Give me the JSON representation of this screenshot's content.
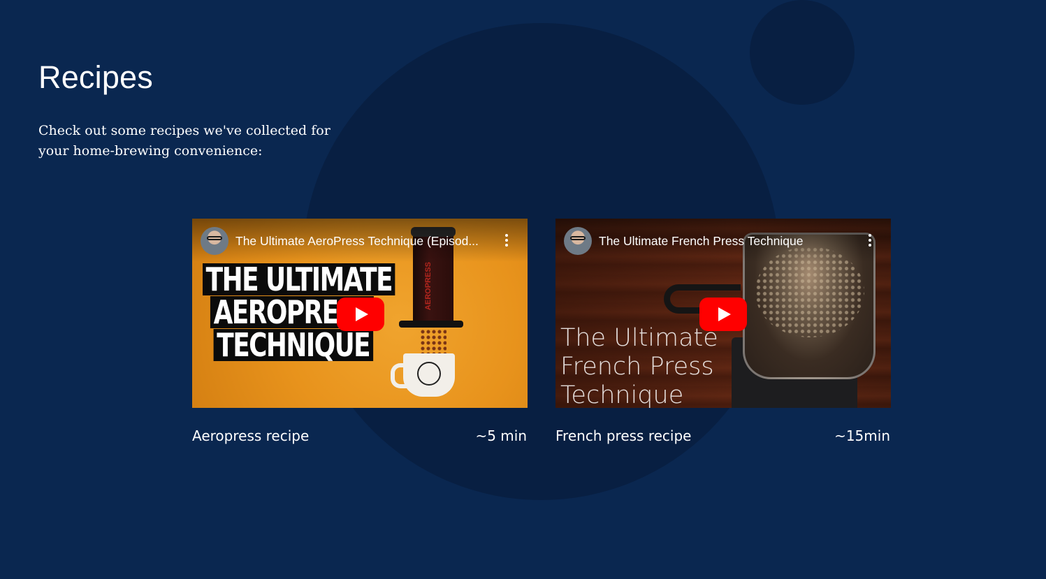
{
  "page": {
    "title": "Recipes",
    "intro": "Check out some recipes we've collected for your home-brewing convenience:"
  },
  "recipes": [
    {
      "video_title": "The Ultimate AeroPress Technique (Episod...",
      "thumbnail_text": [
        "THE ULTIMATE",
        "AEROPRESS",
        "TECHNIQUE"
      ],
      "device_brand": "AEROPRESS",
      "name": "Aeropress recipe",
      "time": "~5 min"
    },
    {
      "video_title": "The Ultimate French Press Technique",
      "thumbnail_text": [
        "The Ultimate",
        "French Press",
        "Technique"
      ],
      "name": "French press recipe",
      "time": "~15min"
    }
  ],
  "icons": {
    "play": "youtube-play-icon",
    "more": "more-vertical-icon",
    "avatar": "channel-avatar"
  },
  "colors": {
    "background": "#0a2750",
    "circle": "#081f42",
    "play_button": "#ff0000",
    "text": "#ffffff"
  }
}
